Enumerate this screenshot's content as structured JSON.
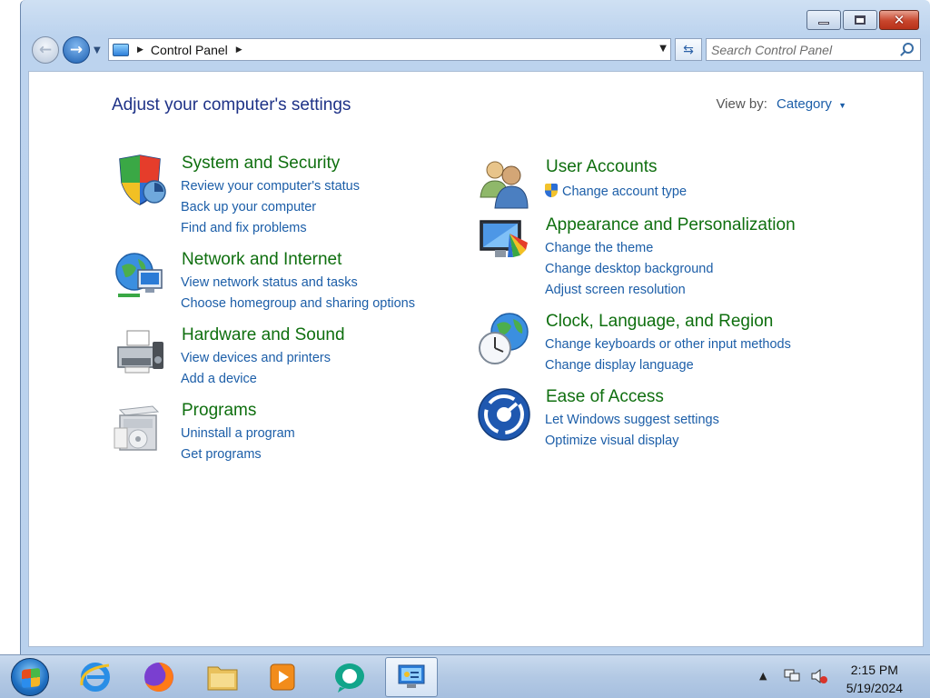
{
  "window": {
    "address_path": "Control Panel",
    "search_placeholder": "Search Control Panel"
  },
  "header": {
    "title": "Adjust your computer's settings",
    "view_by_label": "View by:",
    "view_by_value": "Category"
  },
  "categories_left": [
    {
      "title": "System and Security",
      "icon": "shield-icon",
      "links": [
        "Review your computer's status",
        "Back up your computer",
        "Find and fix problems"
      ]
    },
    {
      "title": "Network and Internet",
      "icon": "network-globe-icon",
      "links": [
        "View network status and tasks",
        "Choose homegroup and sharing options"
      ]
    },
    {
      "title": "Hardware and Sound",
      "icon": "printer-icon",
      "links": [
        "View devices and printers",
        "Add a device"
      ]
    },
    {
      "title": "Programs",
      "icon": "programs-box-icon",
      "links": [
        "Uninstall a program",
        "Get programs"
      ]
    }
  ],
  "categories_right": [
    {
      "title": "User Accounts",
      "icon": "users-icon",
      "links": [
        "Change account type"
      ]
    },
    {
      "title": "Appearance and Personalization",
      "icon": "monitor-colors-icon",
      "links": [
        "Change the theme",
        "Change desktop background",
        "Adjust screen resolution"
      ]
    },
    {
      "title": "Clock, Language, and Region",
      "icon": "clock-globe-icon",
      "links": [
        "Change keyboards or other input methods",
        "Change display language"
      ]
    },
    {
      "title": "Ease of Access",
      "icon": "ease-of-access-icon",
      "links": [
        "Let Windows suggest settings",
        "Optimize visual display"
      ]
    }
  ],
  "taskbar": {
    "time": "2:15 PM",
    "date": "5/19/2024",
    "apps": [
      "internet-explorer-icon",
      "firefox-icon",
      "file-explorer-icon",
      "media-player-icon",
      "chat-app-icon",
      "control-panel-icon"
    ]
  }
}
